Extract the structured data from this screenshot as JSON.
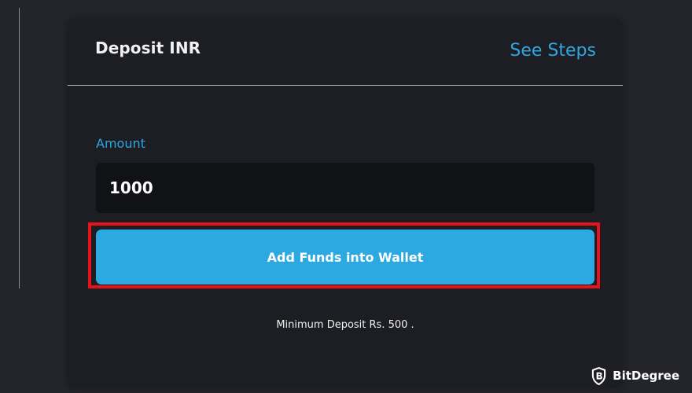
{
  "deposit_card": {
    "title": "Deposit INR",
    "see_steps_label": "See Steps"
  },
  "amount": {
    "label": "Amount",
    "value": "1000"
  },
  "add_funds_button": {
    "label": "Add Funds into Wallet"
  },
  "minimum_deposit_text": "Minimum Deposit Rs. 500 .",
  "watermark": {
    "text": "BitDegree",
    "icon": "bitdegree-shield-logo-icon"
  },
  "colors": {
    "page_background": "#24252b",
    "card_background": "#1d1e23",
    "accent": "#2ea6e1",
    "button": "#2ca9e1",
    "highlight": "#e8121a",
    "input_background": "#111216"
  }
}
